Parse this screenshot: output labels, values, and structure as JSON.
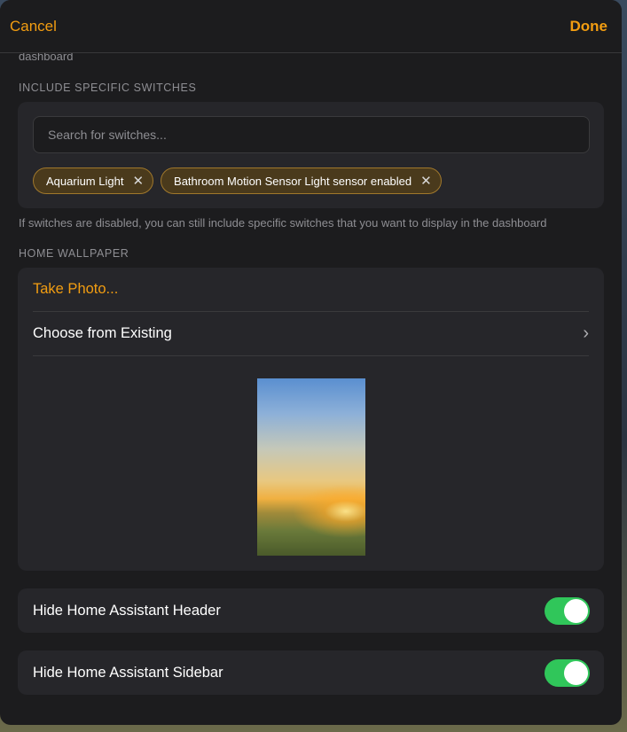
{
  "nav": {
    "cancel": "Cancel",
    "done": "Done"
  },
  "top_footer": "dashboard",
  "switches_section": {
    "header": "INCLUDE SPECIFIC SWITCHES",
    "search_placeholder": "Search for switches...",
    "chips": [
      {
        "label": "Aquarium Light"
      },
      {
        "label": "Bathroom Motion Sensor Light sensor enabled"
      }
    ],
    "chip_close_glyph": "✕",
    "footer": "If switches are disabled, you can still include specific switches that you want to display in the dashboard"
  },
  "wallpaper_section": {
    "header": "HOME WALLPAPER",
    "take_photo": "Take Photo...",
    "choose_existing": "Choose from Existing",
    "chevron_glyph": "›"
  },
  "toggles": [
    {
      "label": "Hide Home Assistant Header",
      "on": true
    },
    {
      "label": "Hide Home Assistant Sidebar",
      "on": true
    }
  ],
  "colors": {
    "accent": "#f29d11",
    "toggle_on": "#30c65a",
    "chip_bg": "#4a3a1c",
    "chip_border": "#a0782c"
  }
}
